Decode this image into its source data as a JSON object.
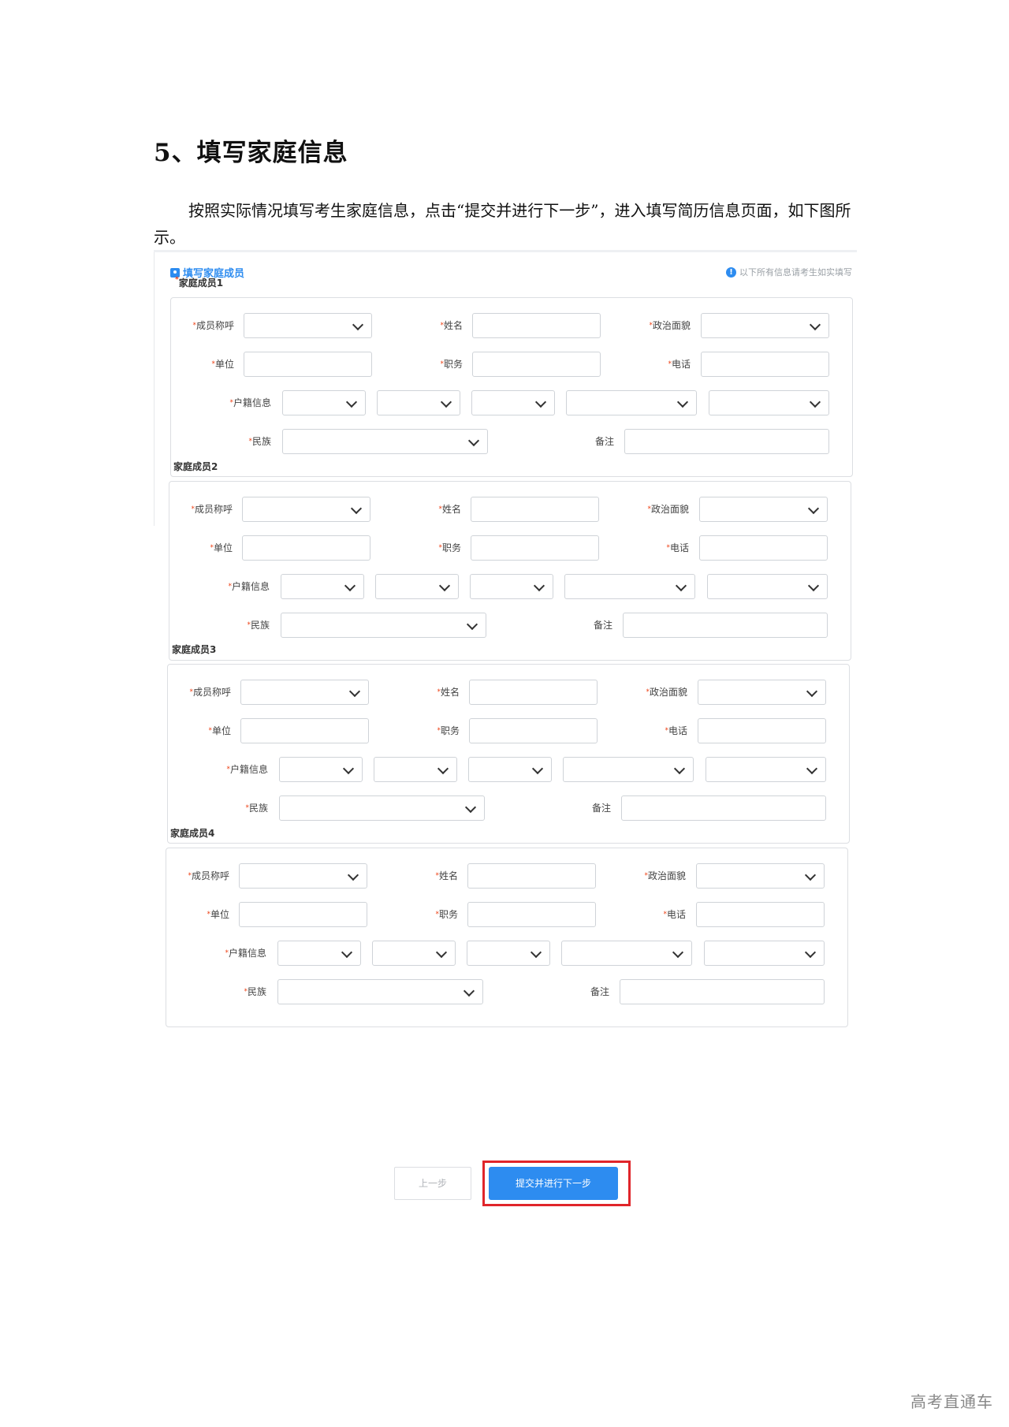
{
  "doc": {
    "heading": "5、填写家庭信息",
    "paragraph": "按照实际情况填写考生家庭信息，点击“提交并进行下一步”，进入填写简历信息页面，如下图所示。"
  },
  "panel": {
    "title": "填写家庭成员",
    "notice": "以下所有信息请考生如实填写",
    "required_mark": "*"
  },
  "labels": {
    "relation": "成员称呼",
    "name": "姓名",
    "political": "政治面貌",
    "employer": "单位",
    "position": "职务",
    "phone": "电话",
    "household": "户籍信息",
    "ethnicity": "民族",
    "remark": "备注"
  },
  "members": [
    {
      "title": "家庭成员1",
      "title_required": true
    },
    {
      "title": "家庭成员2",
      "title_required": false
    },
    {
      "title": "家庭成员3",
      "title_required": false
    },
    {
      "title": "家庭成员4",
      "title_required": false
    }
  ],
  "buttons": {
    "prev": "上一步",
    "next": "提交并进行下一步"
  },
  "watermark": "高考直通车",
  "colors": {
    "accent": "#2d8cf0",
    "required": "#ed4014",
    "highlight_frame": "#e0252a"
  }
}
